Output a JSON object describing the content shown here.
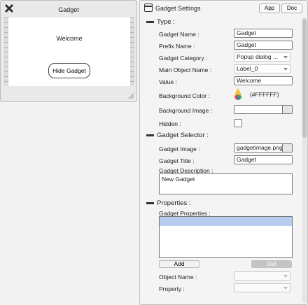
{
  "preview": {
    "title": "Gadget",
    "welcome_text": "Welcome",
    "hide_button_label": "Hide Gadget"
  },
  "settings": {
    "title": "Gadget Settings",
    "app_button": "App",
    "doc_button": "Doc",
    "type_section": "Type :",
    "gadget_name_label": "Gadget Name :",
    "gadget_name_value": "Gadget",
    "prefix_name_label": "Prefix Name :",
    "prefix_name_value": "Gadget",
    "gadget_category_label": "Gadget Category :",
    "gadget_category_value": "Popup dialog ...",
    "main_object_label": "Main Object Name :",
    "main_object_value": "Label_0",
    "value_label": "Value :",
    "value_value": "Welcome",
    "bg_color_label": "Background Color :",
    "bg_color_value": "(#FFFFFF)",
    "bg_image_label": "Background Image :",
    "bg_image_value": "",
    "hidden_label": "Hidden :",
    "selector_section": "Gadget Selector :",
    "gadget_image_label": "Gadget Image :",
    "gadget_image_value": "gadgetimage.png",
    "gadget_title_label": "Gadget Title :",
    "gadget_title_value": "Gadget",
    "gadget_description_label": "Gadget Description :",
    "gadget_description_value": "New Gadget",
    "properties_section": "Properties :",
    "gadget_properties_label": "Gadget Properties :",
    "add_button": "Add",
    "del_button": "Del",
    "object_name_label": "Object Name :",
    "object_name_value": "",
    "property_label": "Property :",
    "property_value": ""
  },
  "icons": [
    "close-icon",
    "resize-grip-icon",
    "settings-window-icon",
    "color-picker-icon",
    "chevron-down-icon",
    "browse-icon"
  ],
  "colors": {
    "list_selection": "#b7cdf0",
    "disabled_button": "#c4c4c4"
  }
}
